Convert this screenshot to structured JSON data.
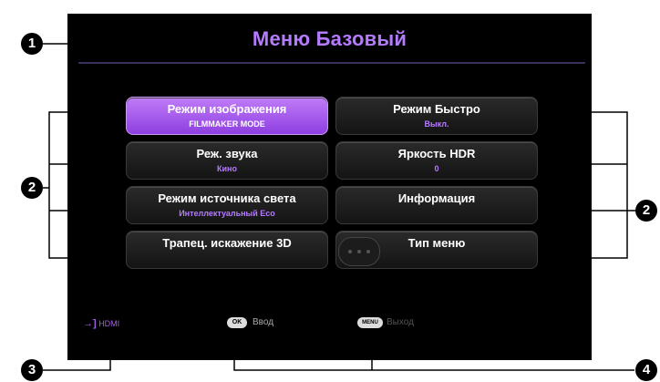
{
  "title": "Меню Базовый",
  "tiles_left": [
    {
      "label": "Режим изображения",
      "value": "FILMMAKER MODE",
      "active": true
    },
    {
      "label": "Реж. звука",
      "value": "Кино"
    },
    {
      "label": "Режим источника света",
      "value": "Интеллектуальный Eco"
    },
    {
      "label": "Трапец. искажение 3D",
      "value": ""
    }
  ],
  "tiles_right": [
    {
      "label": "Режим Быстро",
      "value": "Выкл."
    },
    {
      "label": "Яркость HDR",
      "value": "0"
    },
    {
      "label": "Информация",
      "value": ""
    },
    {
      "label": "Тип меню",
      "value": ""
    }
  ],
  "footer": {
    "source_icon": "input-source-icon",
    "source_label": "HDMI",
    "ok_key": "OK",
    "ok_label": "Ввод",
    "menu_key": "MENU",
    "menu_label": "Выход"
  },
  "callouts": [
    "1",
    "2",
    "2",
    "3",
    "4"
  ],
  "colors": {
    "accent": "#b57bff",
    "active_tile": "#a65af0",
    "screen": "#000000"
  }
}
